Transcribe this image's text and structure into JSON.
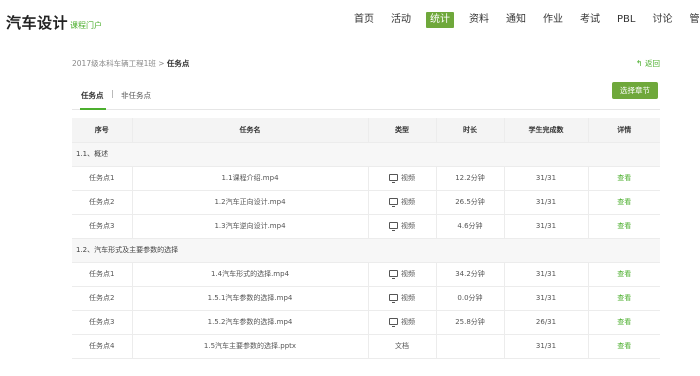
{
  "brand": {
    "title": "汽车设计",
    "subtitle": "课程门户"
  },
  "nav": {
    "items": [
      {
        "label": "首页",
        "active": false
      },
      {
        "label": "活动",
        "active": false
      },
      {
        "label": "统计",
        "active": true
      },
      {
        "label": "资料",
        "active": false
      },
      {
        "label": "通知",
        "active": false
      },
      {
        "label": "作业",
        "active": false
      },
      {
        "label": "考试",
        "active": false
      },
      {
        "label": "PBL",
        "active": false
      },
      {
        "label": "讨论",
        "active": false
      },
      {
        "label": "管",
        "active": false
      }
    ]
  },
  "breadcrumb": {
    "parent": "2017级本科车辆工程1班",
    "separator": " > ",
    "current": "任务点"
  },
  "back_label": "返回",
  "tabs": {
    "active": "任务点",
    "separator": "|",
    "other": "非任务点"
  },
  "chapter_button": "选择章节",
  "table": {
    "headers": [
      "序号",
      "任务名",
      "类型",
      "时长",
      "学生完成数",
      "详情"
    ],
    "sections": [
      {
        "title": "1.1、概述",
        "rows": [
          {
            "index": "任务点1",
            "name": "1.1课程介绍.mp4",
            "type": "视频",
            "duration": "12.2分钟",
            "done": "31/31",
            "detail": "查看"
          },
          {
            "index": "任务点2",
            "name": "1.2汽车正向设计.mp4",
            "type": "视频",
            "duration": "26.5分钟",
            "done": "31/31",
            "detail": "查看"
          },
          {
            "index": "任务点3",
            "name": "1.3汽车逆向设计.mp4",
            "type": "视频",
            "duration": "4.6分钟",
            "done": "31/31",
            "detail": "查看"
          }
        ]
      },
      {
        "title": "1.2、汽车形式及主要参数的选择",
        "rows": [
          {
            "index": "任务点1",
            "name": "1.4汽车形式的选择.mp4",
            "type": "视频",
            "duration": "34.2分钟",
            "done": "31/31",
            "detail": "查看"
          },
          {
            "index": "任务点2",
            "name": "1.5.1汽车参数的选择.mp4",
            "type": "视频",
            "duration": "0.0分钟",
            "done": "31/31",
            "detail": "查看"
          },
          {
            "index": "任务点3",
            "name": "1.5.2汽车参数的选择.mp4",
            "type": "视频",
            "duration": "25.8分钟",
            "done": "26/31",
            "detail": "查看"
          },
          {
            "index": "任务点4",
            "name": "1.5汽车主要参数的选择.pptx",
            "type": "文档",
            "duration": "",
            "done": "31/31",
            "detail": "查看"
          }
        ]
      }
    ]
  },
  "colors": {
    "accent": "#6fa83b",
    "link": "#4caf2e"
  },
  "icons": {
    "video": "monitor-icon",
    "back": "back-arrow-icon"
  }
}
